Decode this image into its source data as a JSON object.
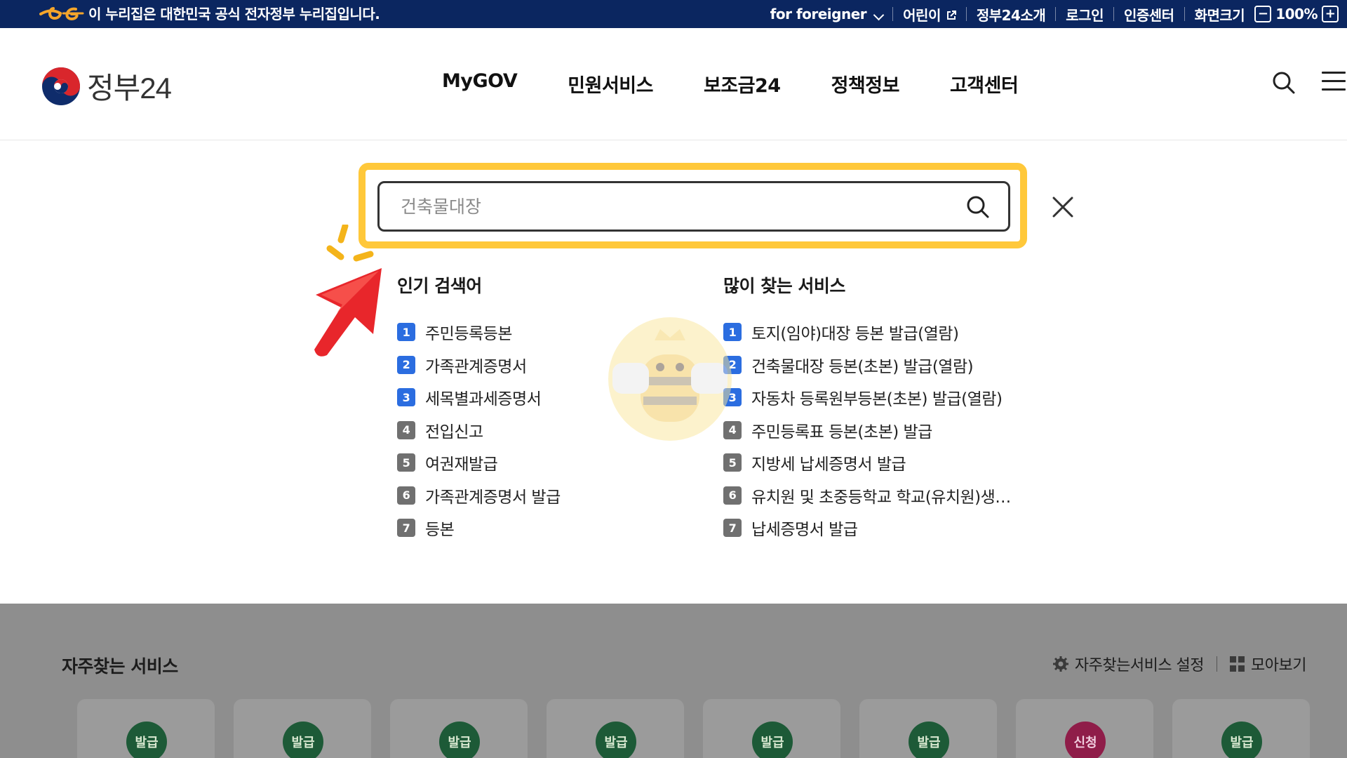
{
  "topbar": {
    "message": "이 누리집은 대한민국 공식 전자정부 누리집입니다.",
    "links": {
      "foreigner": "for foreigner",
      "kids": "어린이",
      "about": "정부24소개",
      "login": "로그인",
      "cert": "인증센터",
      "screen_size": "화면크기",
      "zoom_minus": "−",
      "zoom_value": "100%",
      "zoom_plus": "+"
    }
  },
  "header": {
    "brand": "정부24",
    "nav": [
      "MyGOV",
      "민원서비스",
      "보조금24",
      "정책정보",
      "고객센터"
    ]
  },
  "search": {
    "placeholder": "건축물대장"
  },
  "popular": {
    "title": "인기 검색어",
    "items": [
      "주민등록등본",
      "가족관계증명서",
      "세목별과세증명서",
      "전입신고",
      "여권재발급",
      "가족관계증명서 발급",
      "등본"
    ]
  },
  "services": {
    "title": "많이 찾는 서비스",
    "items": [
      "토지(임야)대장 등본 발급(열람)",
      "건축물대장 등본(초본) 발급(열람)",
      "자동차 등록원부등본(초본) 발급(열람)",
      "주민등록표 등본(초본) 발급",
      "지방세 납세증명서 발급",
      "유치원 및 초중등학교 학교(유치원)생…",
      "납세증명서 발급"
    ]
  },
  "ranks": [
    "1",
    "2",
    "3",
    "4",
    "5",
    "6",
    "7"
  ],
  "favorites": {
    "title": "자주찾는 서비스",
    "settings": "자주찾는서비스 설정",
    "view_all": "모아보기",
    "cards": [
      "발급",
      "발급",
      "발급",
      "발급",
      "발급",
      "발급",
      "신청",
      "발급"
    ]
  },
  "colors": {
    "topbar_bg": "#0b2660",
    "highlight": "#ffc83a",
    "rank_hot": "#2b6de0",
    "rank_normal": "#707070",
    "pointer_red": "#e8262b"
  }
}
